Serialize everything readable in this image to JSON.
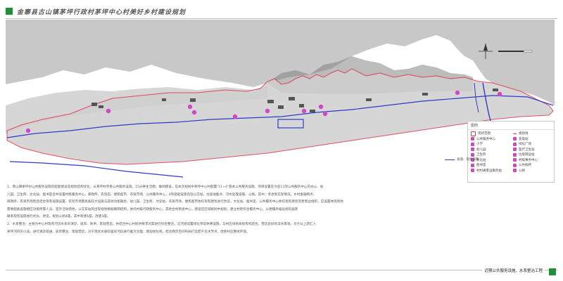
{
  "header": {
    "title": "金寨县古山镇茅坪行政村茅坪中心村美好乡村建设规划",
    "accent_color": "#1f8f3a"
  },
  "map": {
    "north_arrow_icon": "north-arrow-icon",
    "colors": {
      "mountain": "#8c8c8c",
      "boundary": "#e0304a",
      "river": "#2a3cc9",
      "facility": "#d147c6",
      "road": "#b0b0b0"
    },
    "road_legend_label": "县道、现状道路"
  },
  "legend": {
    "title": "图例",
    "items": [
      "现状范围",
      "规划线",
      "公共服务中心",
      "变电站",
      "小学",
      "绿化广场",
      "幼儿园",
      "医疗卫生站",
      "卫生所",
      "垃圾转运站",
      "文化站",
      "村级事务中心",
      "图书室",
      "公共厕所",
      "村村通客运服务站",
      "公厕"
    ]
  },
  "notes": {
    "line1": "1、青山镇茅坪村公共服务设施的配套建设及规划结构优化，从茅坪村完善公共服务设施，15分钟生活圈，做到建设，在本次规划中茅坪中心村配置\"11+4\"基本公共服务设施，项目设置在今后11项公共服务中心的办公、幼",
    "line2": "儿园、卫生所、文化站、图书室合并设置村级服务中心、邮政所、农贸店、便民超市、农资市场、公共服务中心，4项基础设施包括公交站、垃圾收集点、污水处理设施、公厕。其中，考虑到实际情况，乡村金融网点、",
    "line3": "邮政所、农资市场暂且结合现有设施设置，农贸市场需具备较大设施与其他功能融合，幼儿园、卫生所、文化站、农资市场、便民超市依托现有建筑进行改造，文化站、图书室、公共服务中心依托现有建筑完善周边组织，应设置休闲场地",
    "line4": "需要配备设施相应功能所需人员、室外活动场地，公交车站的出现规划根据路网结构，依托村级行政服务中心，其他合村民组中心，建设在区域规划中规划，建立村民综合服务中心，以便服务偏远组的居民",
    "line5": "联系现有设施进行优化、改造，规划公厕4座，其中新建1座，改建3座。",
    "line6": "2、水系整治：主要为中心村现有河流水系的清淤、驳岸、防洪、景观营造，并结合中心村防洪要求对其进行综合整治，沿河道设置绿化带及休憩设施，与村庄绿地系统有机结合，营造良好的滨水景观，对于从上游汇入",
    "line7": "茅坪河内的小溪，进行清淤疏通、驳岸整治、景观营造，对于现状水质较差的河段进行截污治理，增加绿化带，结合两岸空间布局打造若干亲水节点，改善村庄整体环境。"
  },
  "footer": {
    "label": "近期公共服务设施、水系整治工程"
  }
}
